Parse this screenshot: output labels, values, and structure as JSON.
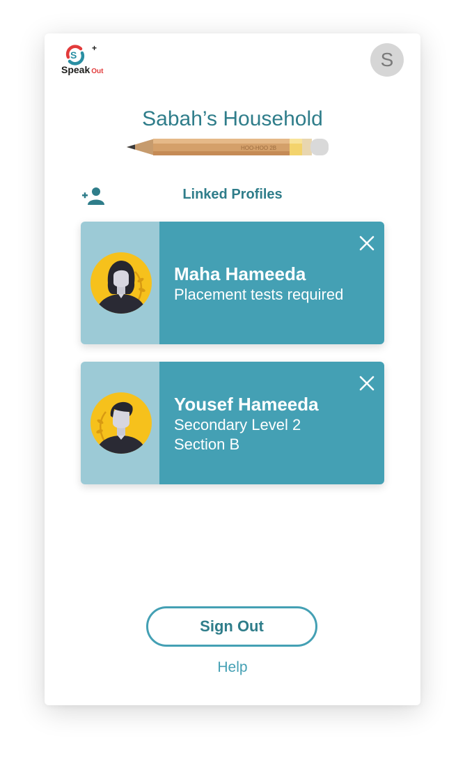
{
  "app": {
    "logo_main": "Speak",
    "logo_sub": "Out",
    "user_initial": "S"
  },
  "household": {
    "title": "Sabah’s Household"
  },
  "linked": {
    "label": "Linked Profiles"
  },
  "profiles": [
    {
      "name": "Maha Hameeda",
      "lines": [
        "Placement tests required"
      ]
    },
    {
      "name": "Yousef Hameeda",
      "lines": [
        "Secondary Level 2",
        "Section B"
      ]
    }
  ],
  "actions": {
    "sign_out": "Sign Out",
    "help": "Help"
  },
  "colors": {
    "teal": "#44a0b4",
    "light_teal": "#9ccad6",
    "heading": "#2f7d8a",
    "avatar_bg": "#d6d6d6",
    "yellow": "#f6c11c",
    "logo_red": "#e23b3b"
  },
  "icons": {
    "logo": "speak-out-logo-icon",
    "add_profile": "add-person-icon",
    "remove": "close-icon"
  }
}
